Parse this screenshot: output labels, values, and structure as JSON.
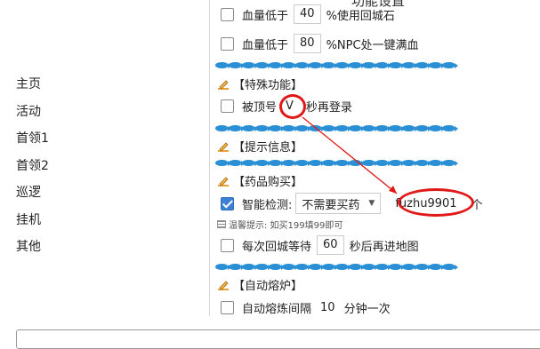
{
  "header": {
    "title": "功能设置"
  },
  "sidebar": {
    "items": [
      {
        "label": "主页"
      },
      {
        "label": "活动"
      },
      {
        "label": "首领1"
      },
      {
        "label": "首领2"
      },
      {
        "label": "巡逻"
      },
      {
        "label": "挂机"
      },
      {
        "label": "其他"
      }
    ]
  },
  "rows": {
    "hp_use": {
      "prefix": "血量低于",
      "value": "40",
      "suffix": "%使用回城石"
    },
    "hp_npc": {
      "prefix": "血量低于",
      "value": "80",
      "suffix": "%NPC处一键满血"
    },
    "relogin": {
      "prefix": "被顶号",
      "value": "V",
      "suffix": "秒再登录"
    },
    "smart_detect": {
      "prefix": "智能检测:",
      "select": "不需要买药",
      "value": "fuzhu9901",
      "suffix": "个"
    },
    "town_wait": {
      "prefix": "每次回城等待",
      "value": "60",
      "suffix": "秒后再进地图"
    },
    "smelt": {
      "prefix": "自动熔炼间隔",
      "value": "10",
      "suffix": "分钟一次"
    }
  },
  "sections": {
    "special": "【特殊功能】",
    "info": "【提示信息】",
    "potion": "【药品购买】",
    "furnace": "【自动熔炉】"
  },
  "hint": "温馨提示: 如买199填99即可",
  "colors": {
    "accent": "#3b82d6",
    "highlight": "#e01818",
    "fish": "#2a8fd4"
  }
}
